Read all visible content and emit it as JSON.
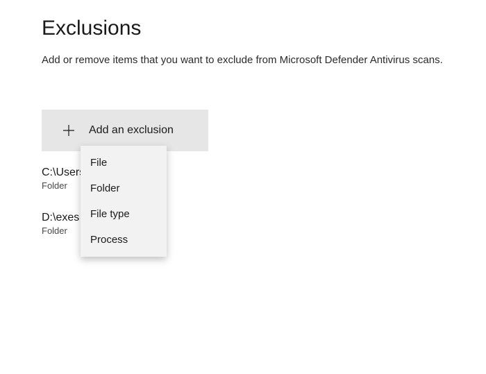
{
  "header": {
    "title": "Exclusions",
    "description": "Add or remove items that you want to exclude from Microsoft Defender Antivirus scans."
  },
  "addButton": {
    "label": "Add an exclusion"
  },
  "menu": {
    "items": [
      {
        "label": "File"
      },
      {
        "label": "Folder"
      },
      {
        "label": "File type"
      },
      {
        "label": "Process"
      }
    ]
  },
  "exclusions": [
    {
      "path": "C:\\Users\\...\\Downloads",
      "kind": "Folder"
    },
    {
      "path": "D:\\exes",
      "kind": "Folder"
    }
  ]
}
